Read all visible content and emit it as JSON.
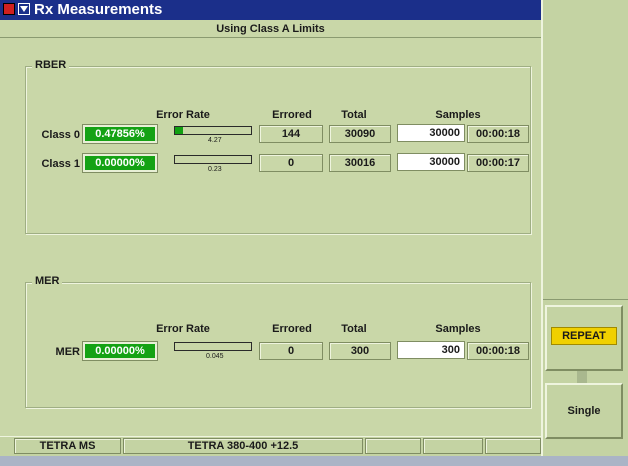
{
  "window": {
    "title": "Rx Measurements",
    "subtitle": "Using Class A Limits"
  },
  "colors": {
    "title_bar": "#1b2f8a",
    "good_value": "#14a214",
    "repeat_highlight": "#f0d000",
    "background": "#c9d7a8"
  },
  "headers": {
    "error_rate": "Error Rate",
    "errored": "Errored",
    "total": "Total",
    "samples": "Samples"
  },
  "rber": {
    "label": "RBER",
    "rows": [
      {
        "name": "Class 0",
        "rate": "0.47856%",
        "bar_fraction": 0.11,
        "bar_label": "4.27",
        "errored": "144",
        "total": "30090",
        "samples": "30000",
        "time": "00:00:18"
      },
      {
        "name": "Class 1",
        "rate": "0.00000%",
        "bar_fraction": 0.0,
        "bar_label": "0.23",
        "errored": "0",
        "total": "30016",
        "samples": "30000",
        "time": "00:00:17"
      }
    ]
  },
  "mer": {
    "label": "MER",
    "row": {
      "name": "MER",
      "rate": "0.00000%",
      "bar_fraction": 0.0,
      "bar_label": "0.045",
      "errored": "0",
      "total": "300",
      "samples": "300",
      "time": "00:00:18"
    }
  },
  "softkeys": {
    "repeat": "REPEAT",
    "single": "Single"
  },
  "status": {
    "mode": "TETRA MS",
    "band": "TETRA 380-400 +12.5"
  }
}
